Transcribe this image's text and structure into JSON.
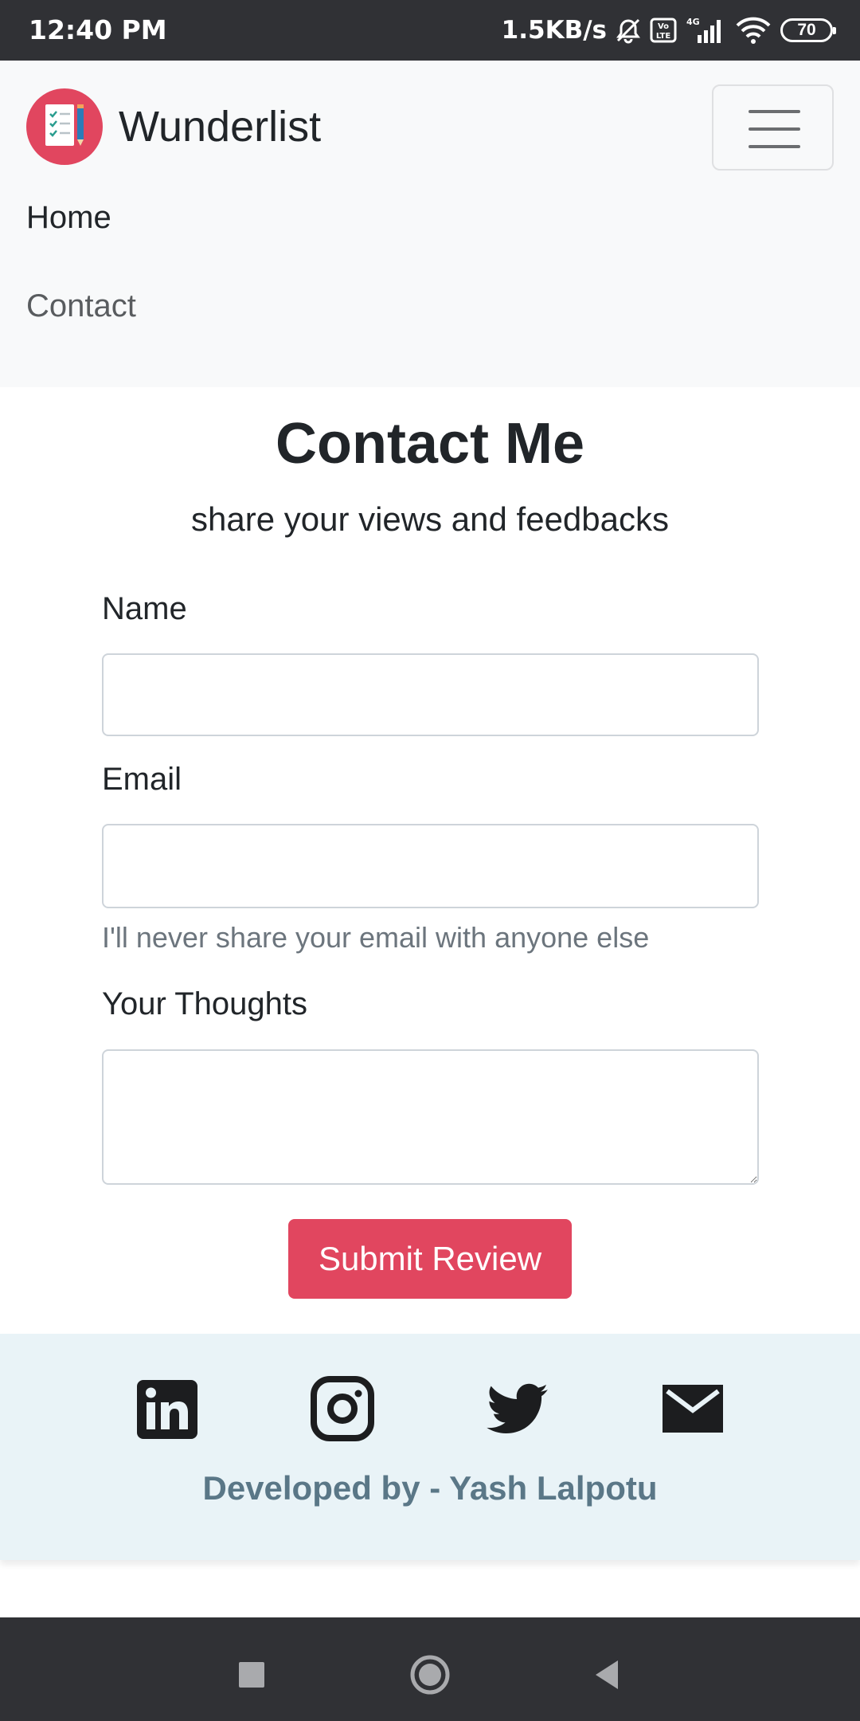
{
  "status_bar": {
    "time": "12:40 PM",
    "net_speed": "1.5KB/s",
    "battery": "70",
    "icons": [
      "silent-alarm-icon",
      "volte-icon",
      "signal-4g-icon",
      "wifi-icon",
      "battery-icon"
    ]
  },
  "navbar": {
    "brand": "Wunderlist",
    "logo_icon": "checklist-notepad-icon",
    "menu_icon": "hamburger-icon",
    "links": [
      "Home",
      "Contact"
    ]
  },
  "contact": {
    "title": "Contact Me",
    "subtitle": "share your views and feedbacks",
    "name_label": "Name",
    "name_value": "",
    "email_label": "Email",
    "email_value": "",
    "email_help": "I'll never share your email with anyone else",
    "thoughts_label": "Your Thoughts",
    "thoughts_value": "",
    "submit_label": "Submit Review"
  },
  "footer": {
    "social_icons": [
      "linkedin-icon",
      "instagram-icon",
      "twitter-icon",
      "email-icon"
    ],
    "credit": "Developed by - Yash Lalpotu"
  },
  "android_nav": {
    "icons": [
      "recents-square-icon",
      "home-circle-icon",
      "back-triangle-icon"
    ]
  },
  "colors": {
    "accent": "#e1465f",
    "navbar_bg": "#f8f9fa",
    "footer_bg": "#e9f3f7",
    "credit_text": "#5a7787",
    "system_bar": "#303135"
  }
}
